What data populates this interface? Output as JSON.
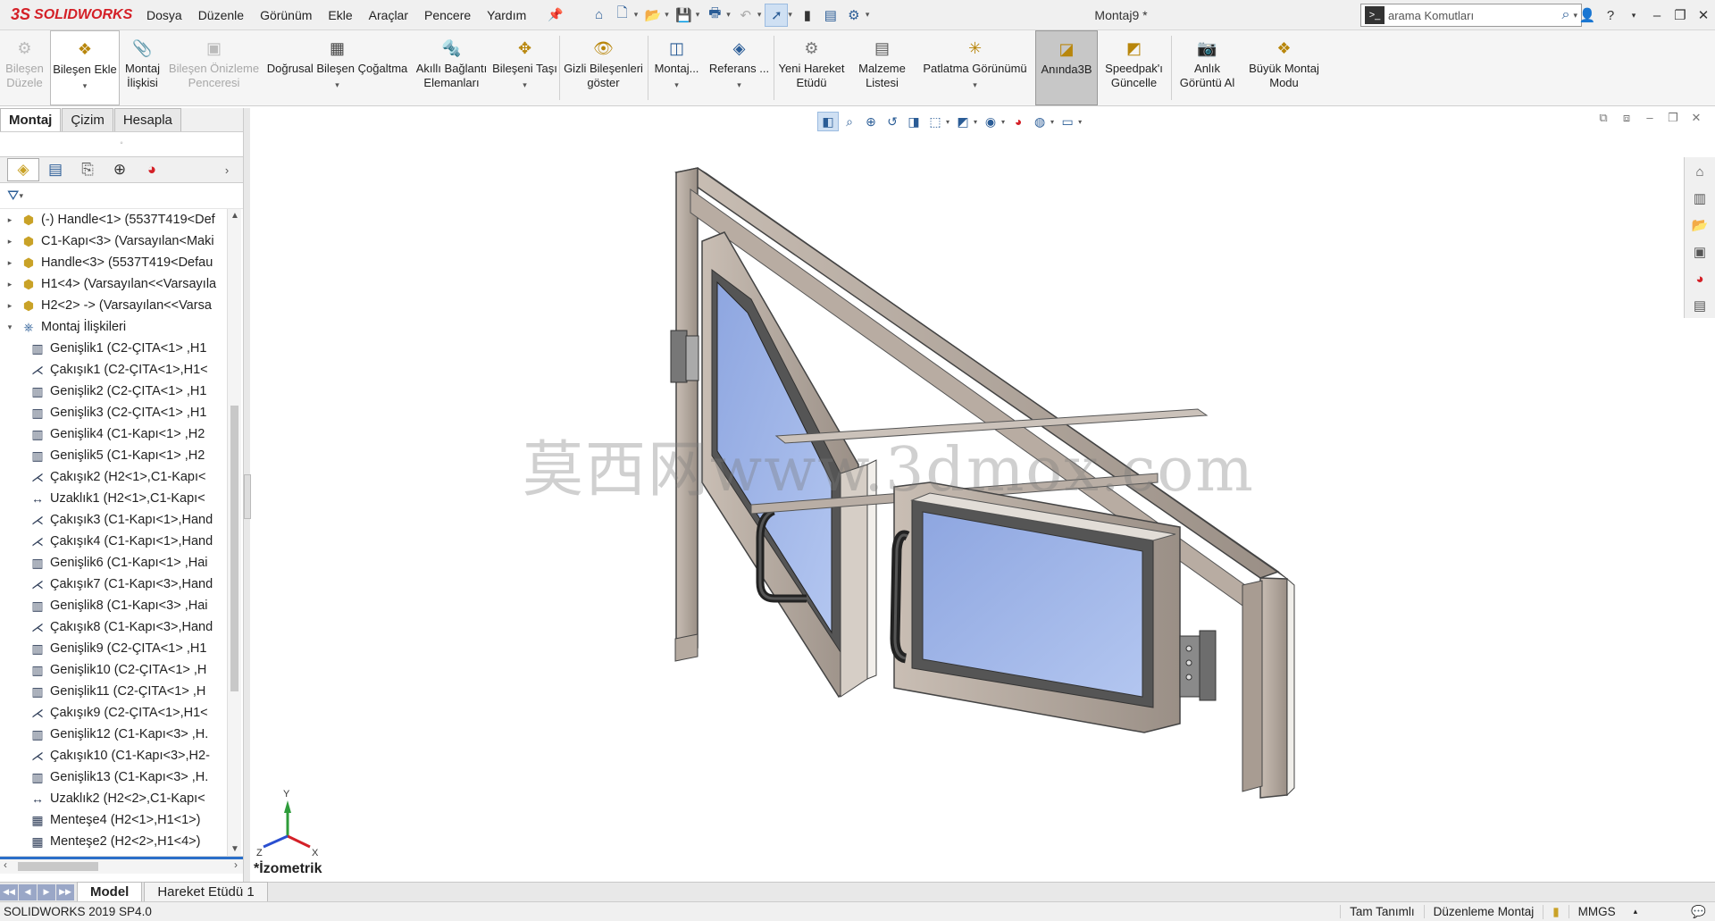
{
  "app": {
    "logo": "SOLIDWORKS",
    "logo_mark": "3S",
    "document_title": "Montaj9 *",
    "menu": [
      "Dosya",
      "Düzenle",
      "Görünüm",
      "Ekle",
      "Araçlar",
      "Pencere",
      "Yardım"
    ],
    "search_placeholder": "arama Komutları",
    "accent": "#d42027"
  },
  "commands": [
    {
      "label": "Bileşen Düzele",
      "icon": "edit-component-icon",
      "disabled": true
    },
    {
      "label": "Bileşen Ekle",
      "icon": "insert-component-icon",
      "disabled": false
    },
    {
      "label": "Montaj İlişkisi",
      "icon": "mate-icon",
      "disabled": false
    },
    {
      "label": "Bileşen Önizleme Penceresi",
      "icon": "preview-window-icon",
      "disabled": true
    },
    {
      "label": "Doğrusal Bileşen Çoğaltma",
      "icon": "linear-pattern-icon",
      "disabled": false
    },
    {
      "label": "Akıllı Bağlantı Elemanları",
      "icon": "smart-fasteners-icon",
      "disabled": false
    },
    {
      "label": "Bileşeni Taşı",
      "icon": "move-component-icon",
      "disabled": false
    },
    {
      "label": "Gizli Bileşenleri göster",
      "icon": "show-hidden-icon",
      "disabled": false
    },
    {
      "label": "Montaj...",
      "icon": "assembly-features-icon",
      "disabled": false
    },
    {
      "label": "Referans ...",
      "icon": "reference-geometry-icon",
      "disabled": false
    },
    {
      "label": "Yeni Hareket Etüdü",
      "icon": "motion-study-icon",
      "disabled": false
    },
    {
      "label": "Malzeme Listesi",
      "icon": "bom-icon",
      "disabled": false
    },
    {
      "label": "Patlatma Görünümü",
      "icon": "exploded-view-icon",
      "disabled": false
    },
    {
      "label": "Anında3B",
      "icon": "instant3d-icon",
      "disabled": false,
      "active": true
    },
    {
      "label": "Speedpak'ı Güncelle",
      "icon": "speedpak-icon",
      "disabled": false
    },
    {
      "label": "Anlık Görüntü Al",
      "icon": "snapshot-icon",
      "disabled": false
    },
    {
      "label": "Büyük Montaj Modu",
      "icon": "large-assembly-icon",
      "disabled": false
    }
  ],
  "left_tabs": [
    "Montaj",
    "Çizim",
    "Hesapla"
  ],
  "tree": {
    "components": [
      "(-) Handle<1> (5537T419<Def",
      "C1-Kapı<3> (Varsayılan<Maki",
      "Handle<3> (5537T419<Defau",
      "H1<4> (Varsayılan<<Varsayıla",
      "H2<2> -> (Varsayılan<<Varsa"
    ],
    "mates_folder": "Montaj İlişkileri",
    "mates": [
      {
        "label": "Genişlik1 (C2-ÇITA<1> ,H1",
        "type": "width"
      },
      {
        "label": "Çakışık1 (C2-ÇITA<1>,H1<",
        "type": "coincident"
      },
      {
        "label": "Genişlik2 (C2-ÇITA<1> ,H1",
        "type": "width"
      },
      {
        "label": "Genişlik3 (C2-ÇITA<1> ,H1",
        "type": "width"
      },
      {
        "label": "Genişlik4 (C1-Kapı<1> ,H2",
        "type": "width"
      },
      {
        "label": "Genişlik5 (C1-Kapı<1> ,H2",
        "type": "width"
      },
      {
        "label": "Çakışık2 (H2<1>,C1-Kapı<",
        "type": "coincident"
      },
      {
        "label": "Uzaklık1 (H2<1>,C1-Kapı<",
        "type": "distance"
      },
      {
        "label": "Çakışık3 (C1-Kapı<1>,Hand",
        "type": "coincident"
      },
      {
        "label": "Çakışık4 (C1-Kapı<1>,Hand",
        "type": "coincident"
      },
      {
        "label": "Genişlik6 (C1-Kapı<1> ,Hai",
        "type": "width"
      },
      {
        "label": "Çakışık7 (C1-Kapı<3>,Hand",
        "type": "coincident"
      },
      {
        "label": "Genişlik8 (C1-Kapı<3> ,Hai",
        "type": "width"
      },
      {
        "label": "Çakışık8 (C1-Kapı<3>,Hand",
        "type": "coincident"
      },
      {
        "label": "Genişlik9 (C2-ÇITA<1> ,H1",
        "type": "width"
      },
      {
        "label": "Genişlik10 (C2-ÇITA<1> ,H",
        "type": "width"
      },
      {
        "label": "Genişlik11 (C2-ÇITA<1> ,H",
        "type": "width"
      },
      {
        "label": "Çakışık9 (C2-ÇITA<1>,H1<",
        "type": "coincident"
      },
      {
        "label": "Genişlik12 (C1-Kapı<3> ,H.",
        "type": "width"
      },
      {
        "label": "Çakışık10 (C1-Kapı<3>,H2-",
        "type": "coincident"
      },
      {
        "label": "Genişlik13 (C1-Kapı<3> ,H.",
        "type": "width"
      },
      {
        "label": "Uzaklık2 (H2<2>,C1-Kapı<",
        "type": "distance"
      },
      {
        "label": "Menteşe4 (H2<1>,H1<1>)",
        "type": "hinge"
      },
      {
        "label": "Menteşe2 (H2<2>,H1<4>)",
        "type": "hinge"
      }
    ]
  },
  "viewport": {
    "view_label": "*İzometrik",
    "watermark": "莫西网www.3dmox.com",
    "triad_axes": [
      "Y",
      "Z",
      "X"
    ]
  },
  "bottom_tabs": [
    "Model",
    "Hareket Etüdü 1"
  ],
  "status": {
    "version": "SOLIDWORKS 2019 SP4.0",
    "definition": "Tam Tanımlı",
    "mode": "Düzenleme Montaj",
    "units": "MMGS"
  }
}
